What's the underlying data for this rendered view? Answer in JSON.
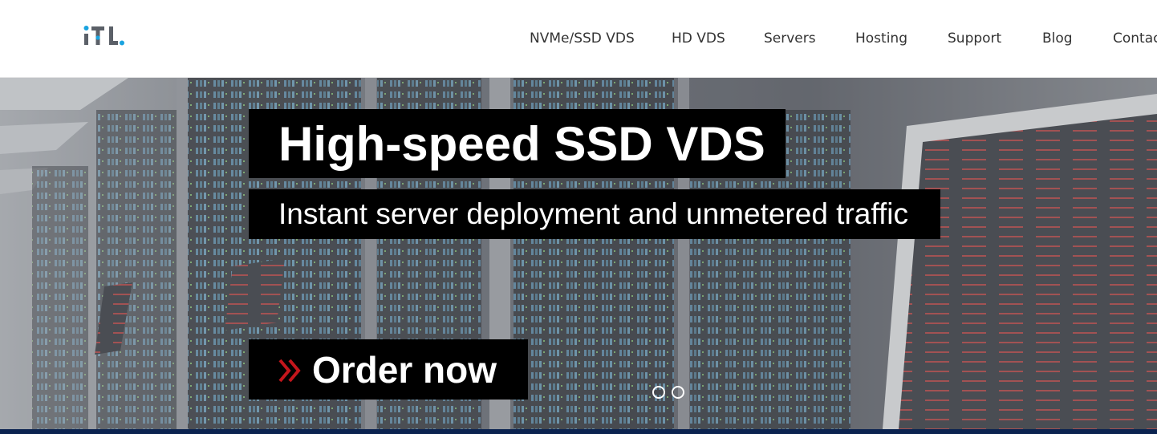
{
  "header": {
    "logo_text": "iTL",
    "nav": [
      {
        "label": "NVMe/SSD VDS"
      },
      {
        "label": "HD VDS"
      },
      {
        "label": "Servers"
      },
      {
        "label": "Hosting"
      },
      {
        "label": "Support"
      },
      {
        "label": "Blog"
      },
      {
        "label": "Contac"
      }
    ]
  },
  "hero": {
    "title": "High-speed SSD VDS",
    "subtitle": "Instant server deployment and unmetered traffic",
    "order_label": "Order now",
    "slides_count": 2
  },
  "colors": {
    "logo_gray": "#5b6068",
    "logo_blue": "#1aa3df",
    "accent_red": "#c4161c",
    "bottom_bar": "#0b2350"
  },
  "icons": {
    "order": "chevron-double-right-icon"
  }
}
